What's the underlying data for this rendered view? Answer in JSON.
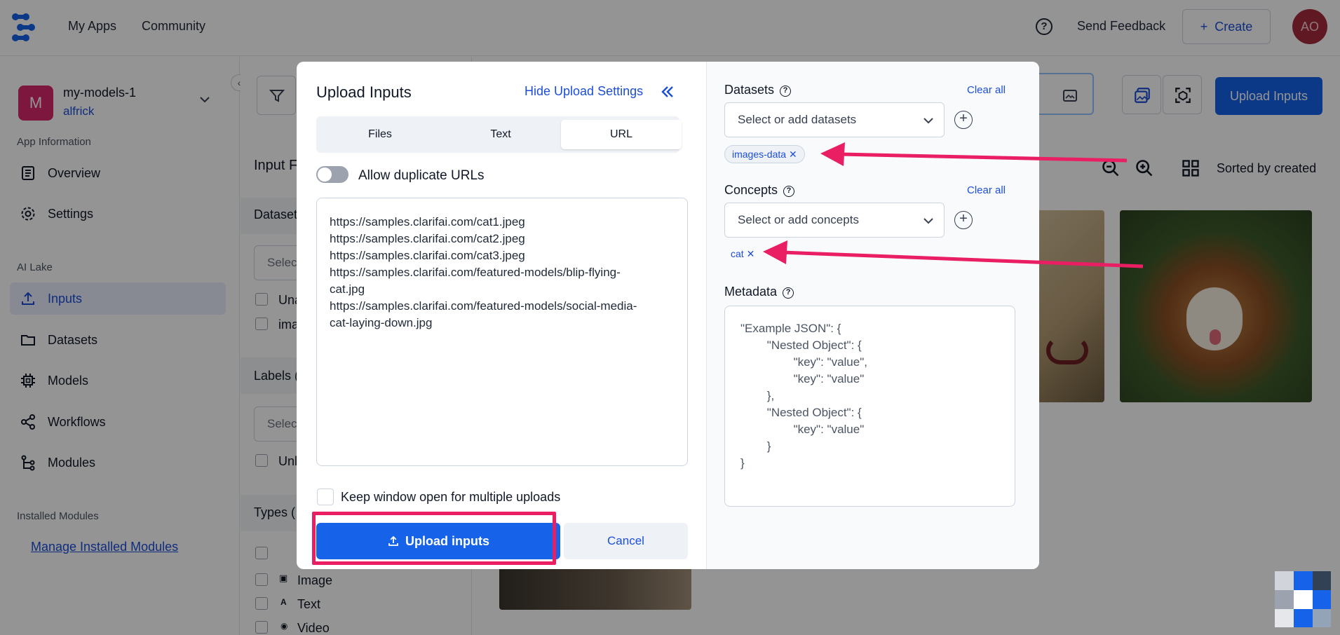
{
  "topbar": {
    "nav": [
      "My Apps",
      "Community"
    ],
    "help_icon": "question-circle-icon",
    "feedback": "Send Feedback",
    "create": "Create",
    "avatar": "AO"
  },
  "sidebar": {
    "project_initial": "M",
    "project_name": "my-models-1",
    "project_user": "alfrick",
    "sections": [
      "App Information",
      "AI Lake",
      "Installed Modules"
    ],
    "items": [
      {
        "label": "Overview",
        "icon": "overview-icon"
      },
      {
        "label": "Settings",
        "icon": "gear-icon"
      },
      {
        "label": "Inputs",
        "icon": "upload-icon",
        "active": true
      },
      {
        "label": "Datasets",
        "icon": "folder-icon"
      },
      {
        "label": "Models",
        "icon": "chip-icon"
      },
      {
        "label": "Workflows",
        "icon": "share-icon"
      },
      {
        "label": "Modules",
        "icon": "modules-icon"
      }
    ],
    "manage": "Manage Installed Modules"
  },
  "filter_panel": {
    "title": "Input F",
    "dataset_label": "Dataset",
    "dataset_select": "Selec",
    "check1": "Una",
    "check2": "ima",
    "labels_label": "Labels (",
    "labels_select": "Selec",
    "check3": "Unl",
    "types_label": "Types (",
    "types": [
      "Image",
      "Text",
      "Video"
    ]
  },
  "main": {
    "upload_button": "Upload Inputs",
    "sorted": "Sorted by created"
  },
  "modal": {
    "title": "Upload Inputs",
    "hide_settings": "Hide Upload Settings",
    "tabs": [
      "Files",
      "Text",
      "URL"
    ],
    "active_tab": "URL",
    "allow_duplicates": "Allow duplicate URLs",
    "urls": [
      "https://samples.clarifai.com/cat1.jpeg",
      "https://samples.clarifai.com/cat2.jpeg",
      "https://samples.clarifai.com/cat3.jpeg",
      "https://samples.clarifai.com/featured-models/blip-flying-",
      "cat.jpg",
      "https://samples.clarifai.com/featured-models/social-media-",
      "cat-laying-down.jpg"
    ],
    "keep_open": "Keep window open for multiple uploads",
    "upload": "Upload inputs",
    "cancel": "Cancel",
    "datasets": {
      "label": "Datasets",
      "clear": "Clear all",
      "placeholder": "Select or add datasets",
      "chip": "images-data"
    },
    "concepts": {
      "label": "Concepts",
      "clear": "Clear all",
      "placeholder": "Select or add concepts",
      "chip": "cat"
    },
    "metadata": {
      "label": "Metadata",
      "lines": [
        "\"Example JSON\": {",
        "        \"Nested Object\": {",
        "                \"key\": \"value\",",
        "                \"key\": \"value\"",
        "        },",
        "        \"Nested Object\": {",
        "                \"key\": \"value\"",
        "        }",
        "}"
      ]
    }
  },
  "colors": {
    "primary": "#1662e8",
    "highlight": "#e91e63",
    "project_badge": "#d9296b",
    "avatar_bg": "#a52a3c"
  }
}
